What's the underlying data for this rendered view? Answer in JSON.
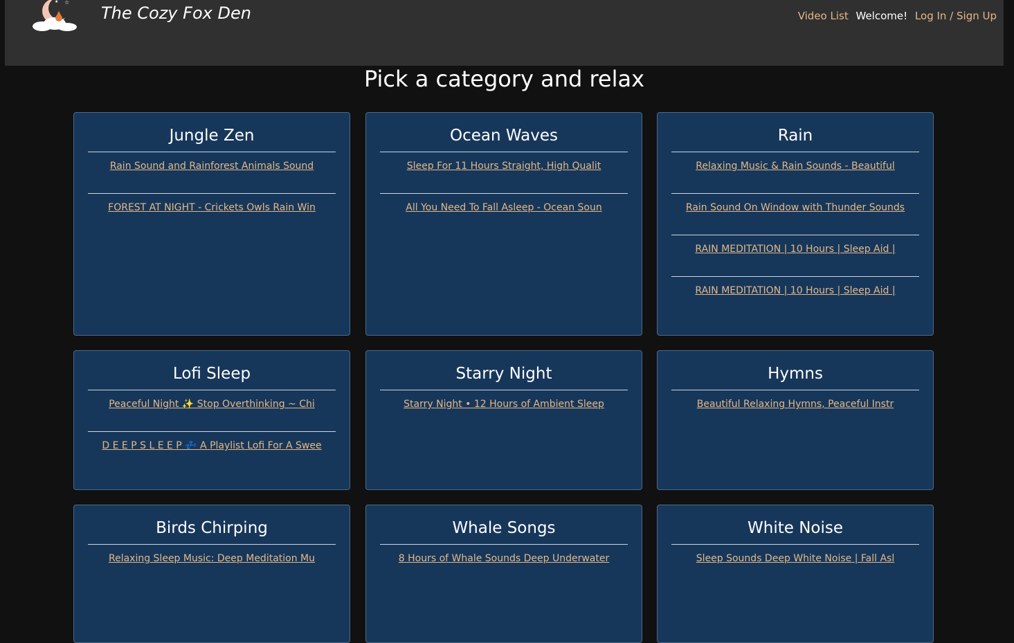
{
  "header": {
    "site_title": "The Cozy Fox Den",
    "nav": {
      "video_list": "Video List",
      "welcome": "Welcome!",
      "login": "Log In / Sign Up"
    }
  },
  "main": {
    "heading": "Pick a category and relax"
  },
  "categories": [
    {
      "title": "Jungle Zen",
      "videos": [
        "Rain Sound and Rainforest Animals Sound",
        "FOREST AT NIGHT - Crickets Owls Rain Win"
      ]
    },
    {
      "title": "Ocean Waves",
      "videos": [
        "Sleep For 11 Hours Straight, High Qualit",
        "All You Need To Fall Asleep - Ocean Soun"
      ]
    },
    {
      "title": "Rain",
      "videos": [
        "Relaxing Music & Rain Sounds - Beautiful",
        "Rain Sound On Window with Thunder Sounds",
        "RAIN MEDITATION | 10 Hours | Sleep Aid |",
        "RAIN MEDITATION | 10 Hours | Sleep Aid |"
      ]
    },
    {
      "title": "Lofi Sleep",
      "videos": [
        "Peaceful Night ✨ Stop Overthinking ~ Chi",
        "D E E P  S L E E P 💤 A Playlist Lofi For A Swee"
      ]
    },
    {
      "title": "Starry Night",
      "videos": [
        "Starry Night • 12 Hours of Ambient Sleep"
      ]
    },
    {
      "title": "Hymns",
      "videos": [
        "Beautiful Relaxing Hymns, Peaceful Instr"
      ]
    },
    {
      "title": "Birds Chirping",
      "videos": [
        "Relaxing Sleep Music: Deep Meditation Mu"
      ]
    },
    {
      "title": "Whale Songs",
      "videos": [
        "8 Hours of Whale Sounds Deep Underwater"
      ]
    },
    {
      "title": "White Noise",
      "videos": [
        "Sleep Sounds Deep White Noise | Fall Asl"
      ]
    }
  ],
  "colors": {
    "background": "#111111",
    "header": "#303030",
    "card": "#17375a",
    "link": "#e3b888"
  }
}
